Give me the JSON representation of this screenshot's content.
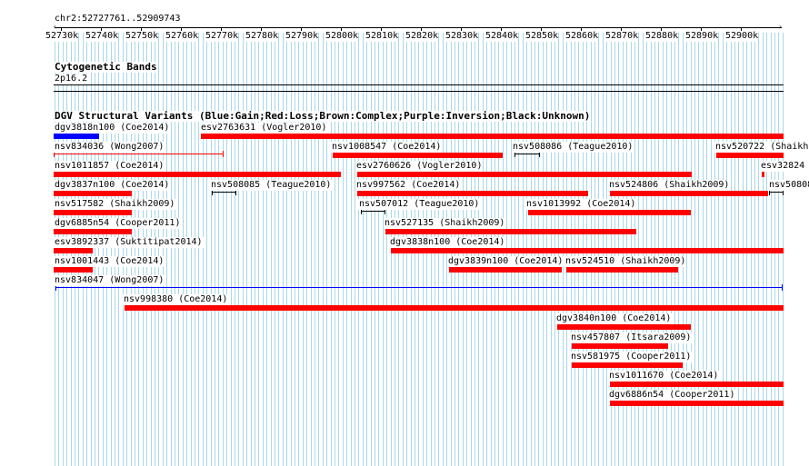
{
  "ruler": {
    "location": "chr2:52727761..52909743",
    "ticks": [
      "52730k",
      "52740k",
      "52750k",
      "52760k",
      "52770k",
      "52780k",
      "52790k",
      "52800k",
      "52810k",
      "52820k",
      "52830k",
      "52840k",
      "52850k",
      "52860k",
      "52870k",
      "52880k",
      "52890k",
      "52900k"
    ]
  },
  "cyto": {
    "title": "Cytogenetic Bands",
    "band": "2p16.2"
  },
  "dgv": {
    "title": "DGV Structural Variants (Blue:Gain;Red:Loss;Brown:Complex;Purple:Inversion;Black:Unknown)",
    "variants": [
      {
        "label": "dgv3818n100 (Coe2014)",
        "type": "gain"
      },
      {
        "label": "esv2763631 (Vogler2010)",
        "type": "loss"
      },
      {
        "label": "nsv834036 (Wong2007)",
        "type": "loss"
      },
      {
        "label": "nsv1008547 (Coe2014)",
        "type": "loss"
      },
      {
        "label": "nsv508086 (Teague2010)",
        "type": "unknown"
      },
      {
        "label": "nsv520722 (Shaikh",
        "type": "loss"
      },
      {
        "label": "nsv1011857 (Coe2014)",
        "type": "loss"
      },
      {
        "label": "esv2760626 (Vogler2010)",
        "type": "loss"
      },
      {
        "label": "esv32824",
        "type": "loss"
      },
      {
        "label": "dgv3837n100 (Coe2014)",
        "type": "loss"
      },
      {
        "label": "nsv508085 (Teague2010)",
        "type": "unknown"
      },
      {
        "label": "nsv997562 (Coe2014)",
        "type": "loss"
      },
      {
        "label": "nsv524806 (Shaikh2009)",
        "type": "loss"
      },
      {
        "label": "nsv50808",
        "type": "unknown"
      },
      {
        "label": "nsv517582 (Shaikh2009)",
        "type": "loss"
      },
      {
        "label": "nsv507012 (Teague2010)",
        "type": "unknown"
      },
      {
        "label": "nsv1013992 (Coe2014)",
        "type": "loss"
      },
      {
        "label": "dgv6885n54 (Cooper2011)",
        "type": "loss"
      },
      {
        "label": "nsv527135 (Shaikh2009)",
        "type": "loss"
      },
      {
        "label": "esv3892337 (Suktitipat2014)",
        "type": "loss"
      },
      {
        "label": "dgv3838n100 (Coe2014)",
        "type": "loss"
      },
      {
        "label": "nsv1001443 (Coe2014)",
        "type": "loss"
      },
      {
        "label": "dgv3839n100 (Coe2014)",
        "type": "loss"
      },
      {
        "label": "nsv524510 (Shaikh2009)",
        "type": "loss"
      },
      {
        "label": "nsv834047 (Wong2007)",
        "type": "gain"
      },
      {
        "label": "nsv998380 (Coe2014)",
        "type": "loss"
      },
      {
        "label": "dgv3840n100 (Coe2014)",
        "type": "loss"
      },
      {
        "label": "nsv457807 (Itsara2009)",
        "type": "loss"
      },
      {
        "label": "nsv581975 (Cooper2011)",
        "type": "loss"
      },
      {
        "label": "nsv1011670 (Coe2014)",
        "type": "loss"
      },
      {
        "label": "dgv6886n54 (Cooper2011)",
        "type": "loss"
      }
    ]
  },
  "colors": {
    "gain": "#0000ff",
    "loss": "#ff0000",
    "complex": "#8b4513",
    "inversion": "#800080",
    "unknown": "#000000",
    "grid": "#a8d8e8"
  }
}
